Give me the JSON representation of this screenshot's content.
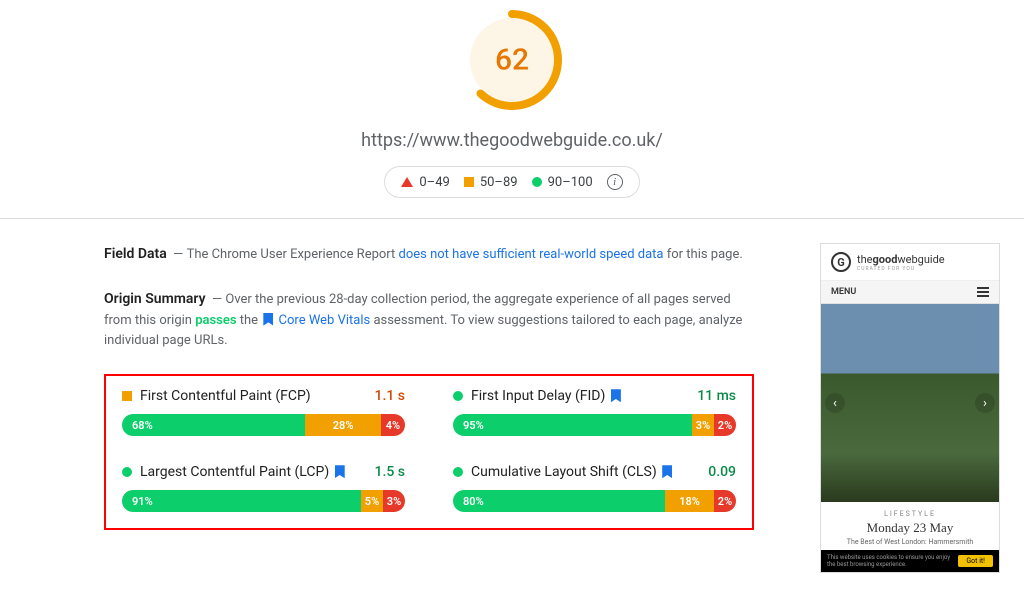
{
  "score": 62,
  "url": "https://www.thegoodwebguide.co.uk/",
  "legend": {
    "poor": "0–49",
    "mid": "50–89",
    "good": "90–100"
  },
  "fieldData": {
    "title": "Field Data",
    "text1": "The Chrome User Experience Report ",
    "link": "does not have sufficient real-world speed data",
    "text2": " for this page."
  },
  "originSummary": {
    "title": "Origin Summary",
    "text1": "Over the previous 28-day collection period, the aggregate experience of all pages served from this origin ",
    "passes": "passes",
    "text2": " the ",
    "cwv": "Core Web Vitals",
    "text3": " assessment. To view suggestions tailored to each page, analyze individual page URLs."
  },
  "metrics": {
    "fcp": {
      "name": "First Contentful Paint (FCP)",
      "value": "1.1 s",
      "dist": [
        68,
        28,
        4
      ]
    },
    "fid": {
      "name": "First Input Delay (FID)",
      "value": "11 ms",
      "dist": [
        95,
        3,
        2
      ],
      "cwv": true
    },
    "lcp": {
      "name": "Largest Contentful Paint (LCP)",
      "value": "1.5 s",
      "dist": [
        91,
        5,
        3
      ],
      "cwv": true
    },
    "cls": {
      "name": "Cumulative Layout Shift (CLS)",
      "value": "0.09",
      "dist": [
        80,
        18,
        2
      ],
      "cwv": true
    }
  },
  "preview": {
    "logoLetter": "G",
    "brand1": "the",
    "brand2": "good",
    "brand3": "webguide",
    "tagline": "CURATED FOR YOU",
    "menu": "MENU",
    "lifestyle": "LIFESTYLE",
    "date": "Monday 23 May",
    "sub": "The Best of West London: Hammersmith",
    "cookie": "This website uses cookies to ensure you enjoy the best browsing experience.",
    "cookieBtn": "Got it!"
  }
}
